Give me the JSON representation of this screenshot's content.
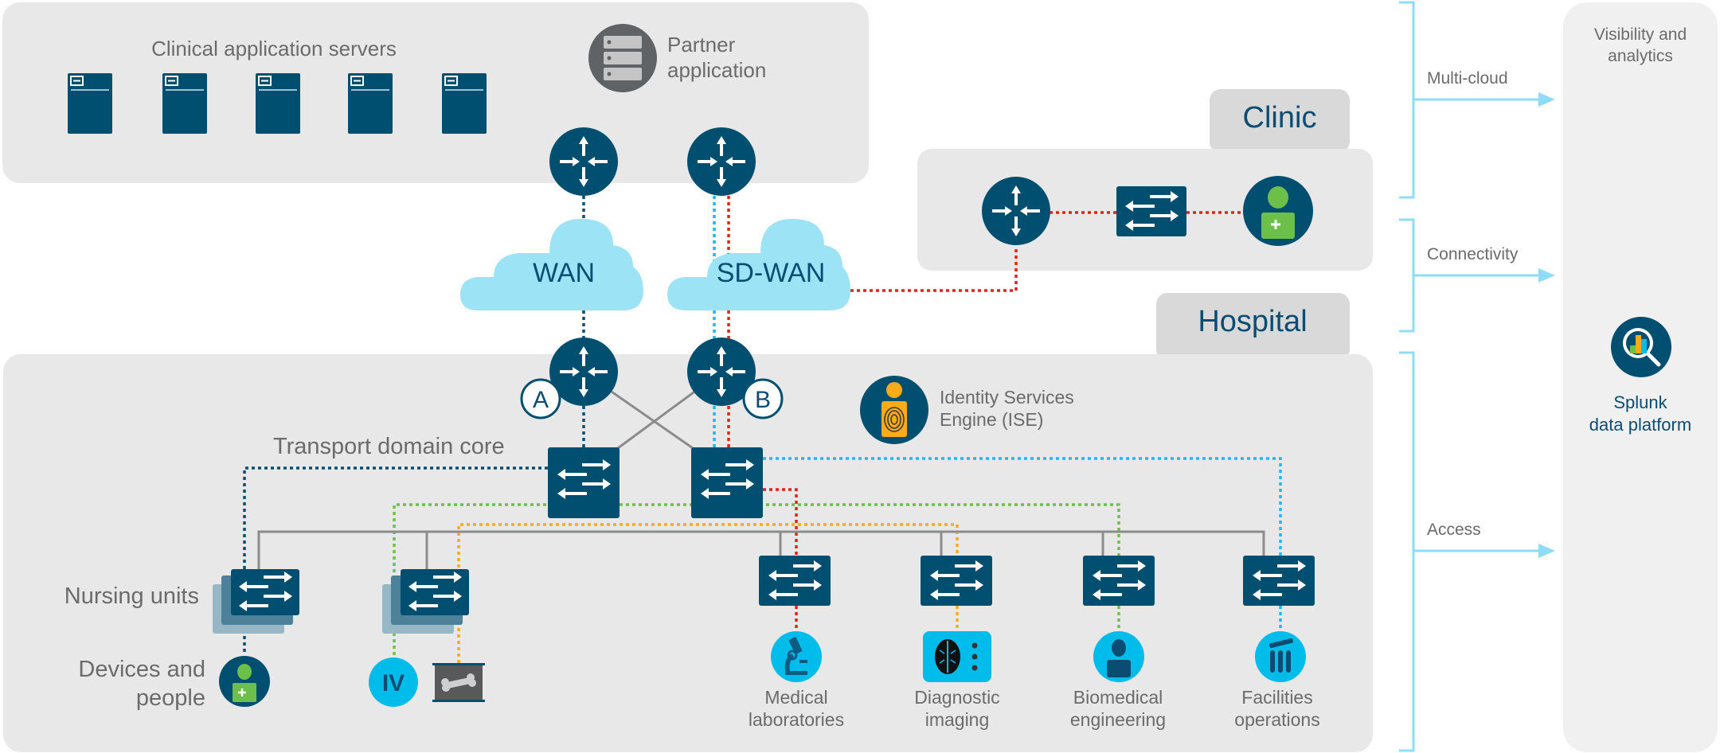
{
  "top_panel": {
    "servers_label": "Clinical application servers",
    "server_count": 5,
    "partner_label_line1": "Partner",
    "partner_label_line2": "application"
  },
  "clouds": {
    "wan": "WAN",
    "sdwan": "SD-WAN"
  },
  "clinic": {
    "tab_label": "Clinic"
  },
  "hospital": {
    "tab_label": "Hospital",
    "router_a_badge": "A",
    "router_b_badge": "B",
    "core_label": "Transport domain core",
    "ise_line1": "Identity Services",
    "ise_line2": "Engine (ISE)",
    "nursing_label": "Nursing units",
    "devices_line1": "Devices and",
    "devices_line2": "people",
    "iv_label": "IV",
    "endpoints": [
      {
        "line1": "Medical",
        "line2": "laboratories",
        "icon": "microscope-icon"
      },
      {
        "line1": "Diagnostic",
        "line2": "imaging",
        "icon": "brain-scan-icon"
      },
      {
        "line1": "Biomedical",
        "line2": "engineering",
        "icon": "person-icon"
      },
      {
        "line1": "Facilities",
        "line2": "operations",
        "icon": "test-tubes-icon"
      }
    ]
  },
  "layers": {
    "multicloud": "Multi-cloud",
    "connectivity": "Connectivity",
    "access": "Access"
  },
  "splunk": {
    "header_line1": "Visibility and",
    "header_line2": "analytics",
    "label_line1": "Splunk",
    "label_line2": "data platform"
  },
  "colors": {
    "device_blue": "#004f71",
    "cloud": "#9ce4f5",
    "link_dark_blue": "#0b4d72",
    "link_light_blue": "#1fb9e8",
    "link_red": "#e2231a",
    "link_green": "#6cc04a",
    "link_orange": "#fbab18",
    "bracket": "#8fdcf8"
  }
}
